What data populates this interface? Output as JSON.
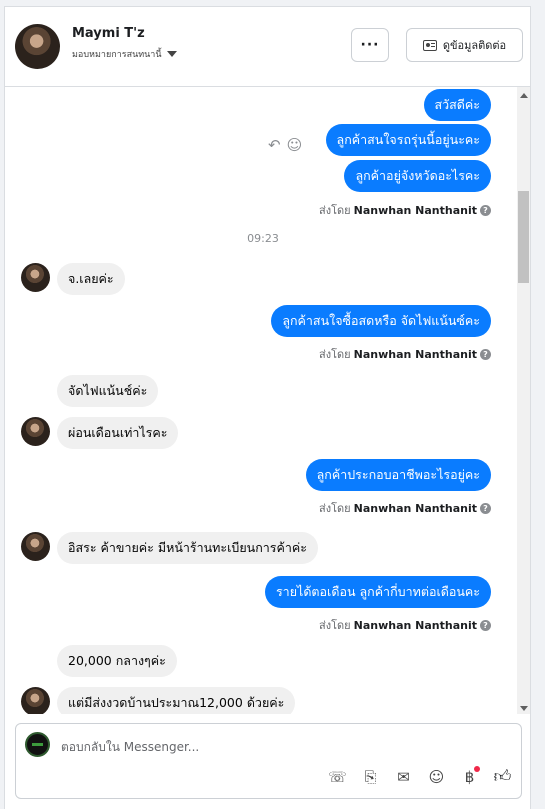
{
  "header": {
    "name": "Maymi T'z",
    "assign_label": "มอบหมายการสนทนานี้",
    "more_label": "···",
    "contact_label": "ดูข้อมูลติดต่อ"
  },
  "messages": {
    "m1": "สวัสดีค่ะ",
    "m2": "ลูกค้าสนใจรถรุ่นนี้อยู่นะคะ",
    "m3": "ลูกค้าอยู่จังหวัดอะไรคะ",
    "time": "09:23",
    "m4": "จ.เลยค่ะ",
    "m5": "ลูกค้าสนใจซื้อสดหรือ จัดไฟแน้นซ์คะ",
    "m6": "จัดไฟแน้นช์ค่ะ",
    "m7": "ผ่อนเดือนเท่าไรคะ",
    "m8": "ลูกค้าประกอบอาชีพอะไรอยู่คะ",
    "m9": "อิสระ ค้าขายค่ะ มีหน้าร้านทะเบียนการค้าค่ะ",
    "m10": "รายได้ตอเดือน ลูกค้ากี่บาทต่อเดือนคะ",
    "m11": "20,000 กลางๆค่ะ",
    "m12": "แต่มีส่งงวดบ้านประมาณ12,000 ด้วยค่ะ"
  },
  "sent_by": {
    "prefix": "ส่งโดย",
    "agent": "Nanwhan Nanthanit"
  },
  "composer": {
    "placeholder": "ตอบกลับใน Messenger..."
  },
  "icons": [
    "more-icon",
    "contact-card-icon",
    "reply-icon",
    "emoji-react-icon",
    "help-icon",
    "call-add-icon",
    "attach-icon",
    "saved-reply-icon",
    "emoji-icon",
    "payment-icon",
    "like-icon"
  ]
}
